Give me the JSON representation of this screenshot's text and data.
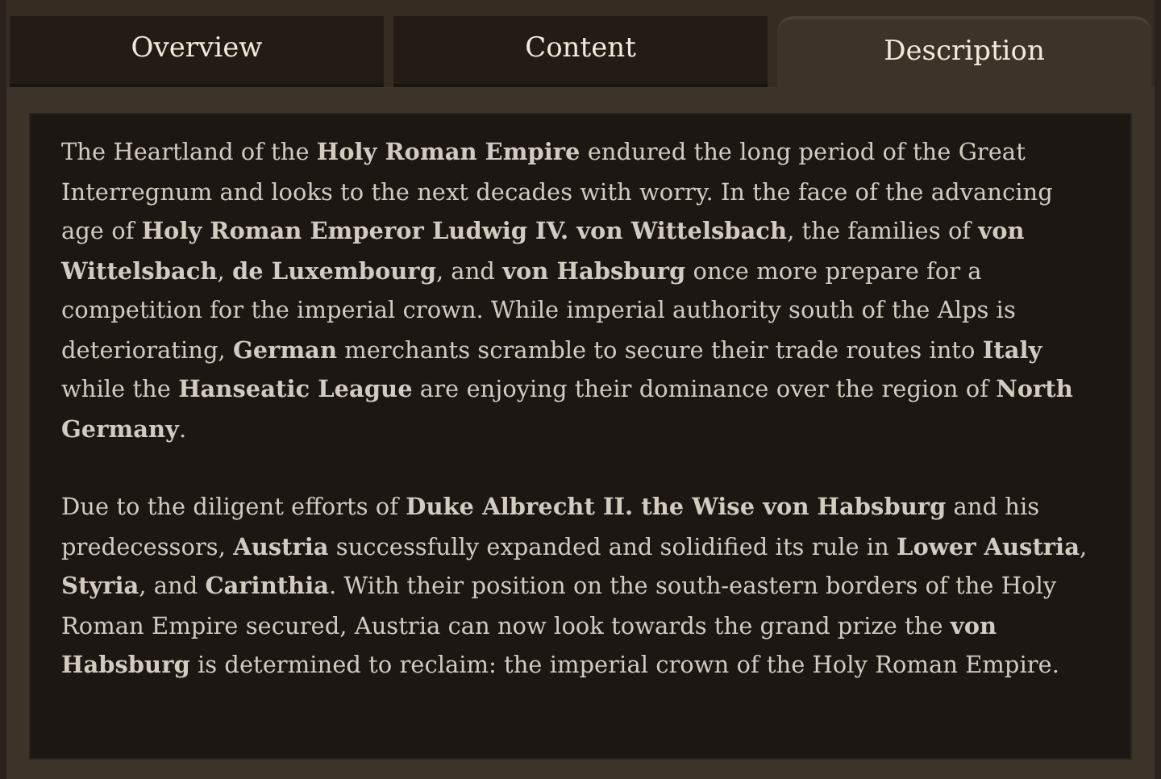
{
  "tabs": [
    {
      "label": "Overview",
      "selected": false
    },
    {
      "label": "Content",
      "selected": false
    },
    {
      "label": "Description",
      "selected": true
    }
  ],
  "description": {
    "paragraphs": [
      "The Heartland of the **Holy Roman Empire** endured the long period of the Great Interregnum and looks to the next decades with worry. In the face of the advancing age of **Holy Roman Emperor Ludwig IV. von Wittelsbach**, the families of **von Wittelsbach**, **de Luxembourg**, and **von Habsburg** once more prepare for a competition for the imperial crown. While imperial authority south of the Alps is deteriorating, **German** merchants scramble to secure their trade routes into **Italy** while the **Hanseatic League** are enjoying their dominance over the region of **North Germany**.",
      "Due to the diligent efforts of **Duke Albrecht II. the Wise von Habsburg** and his predecessors, **Austria** successfully expanded and solidified its rule in **Lower Austria**, **Styria**, and **Carinthia**. With their position on the south-eastern borders of the Holy Roman Empire secured, Austria can now look towards the grand prize the **von Habsburg** is determined to reclaim: the imperial crown of the Holy Roman Empire."
    ]
  }
}
